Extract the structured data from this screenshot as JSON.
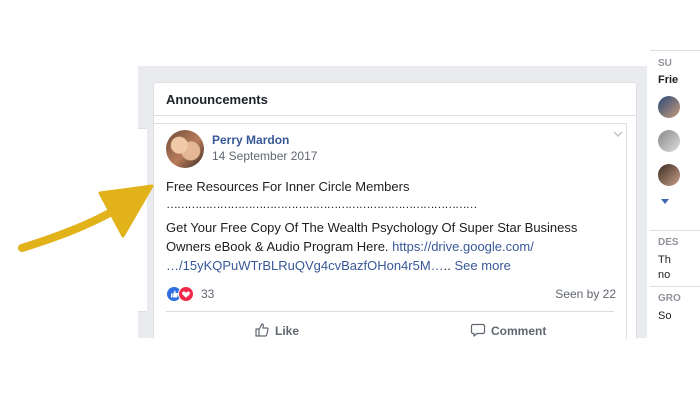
{
  "group": {
    "section_title": "Announcements"
  },
  "post": {
    "author": "Perry Mardon",
    "date": "14 September 2017",
    "title": "Free Resources For Inner Circle Members",
    "separator": "……………………………………………………………………………",
    "body_line1": "Get Your Free Copy Of The Wealth Psychology Of Super Star Business",
    "body_line2_text": "Owners eBook & Audio Program Here. ",
    "link_part1": "https://drive.google.com/",
    "link_part2": "…/15yKQPuWTrBLRuQVg4cvBazfOHon4r5M…",
    "ellipsis": ".. ",
    "see_more": "See more",
    "reaction_count": "33",
    "seen_by": "Seen by 22",
    "like_label": "Like",
    "comment_label": "Comment"
  },
  "right_column": {
    "top_label": "SU",
    "friends_label": "Frie",
    "desc_label": "DES",
    "desc_line1": "Th",
    "desc_line2": "no",
    "group_label": "GRO",
    "group_line": "So"
  },
  "annotation": {
    "arrow_color": "#e1b21a"
  },
  "icons": [
    "thumbs-up-reaction-icon",
    "love-reaction-icon",
    "like-icon",
    "comment-icon",
    "chevron-down-icon",
    "arrow-icon"
  ]
}
